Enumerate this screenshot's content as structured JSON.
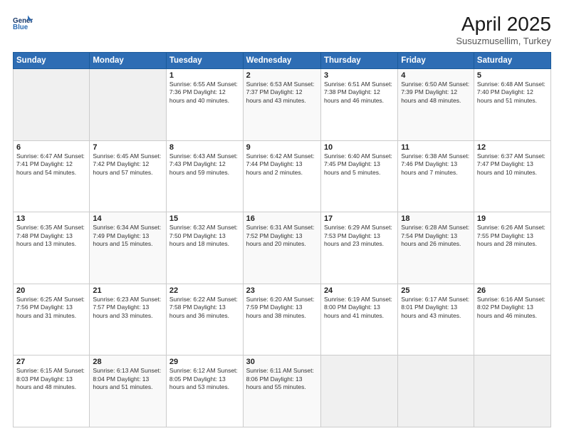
{
  "header": {
    "title": "April 2025",
    "subtitle": "Susuzmusellim, Turkey",
    "logo_line1": "General",
    "logo_line2": "Blue"
  },
  "days": [
    "Sunday",
    "Monday",
    "Tuesday",
    "Wednesday",
    "Thursday",
    "Friday",
    "Saturday"
  ],
  "weeks": [
    [
      {
        "day": "",
        "info": ""
      },
      {
        "day": "",
        "info": ""
      },
      {
        "day": "1",
        "info": "Sunrise: 6:55 AM\nSunset: 7:36 PM\nDaylight: 12 hours and 40 minutes."
      },
      {
        "day": "2",
        "info": "Sunrise: 6:53 AM\nSunset: 7:37 PM\nDaylight: 12 hours and 43 minutes."
      },
      {
        "day": "3",
        "info": "Sunrise: 6:51 AM\nSunset: 7:38 PM\nDaylight: 12 hours and 46 minutes."
      },
      {
        "day": "4",
        "info": "Sunrise: 6:50 AM\nSunset: 7:39 PM\nDaylight: 12 hours and 48 minutes."
      },
      {
        "day": "5",
        "info": "Sunrise: 6:48 AM\nSunset: 7:40 PM\nDaylight: 12 hours and 51 minutes."
      }
    ],
    [
      {
        "day": "6",
        "info": "Sunrise: 6:47 AM\nSunset: 7:41 PM\nDaylight: 12 hours and 54 minutes."
      },
      {
        "day": "7",
        "info": "Sunrise: 6:45 AM\nSunset: 7:42 PM\nDaylight: 12 hours and 57 minutes."
      },
      {
        "day": "8",
        "info": "Sunrise: 6:43 AM\nSunset: 7:43 PM\nDaylight: 12 hours and 59 minutes."
      },
      {
        "day": "9",
        "info": "Sunrise: 6:42 AM\nSunset: 7:44 PM\nDaylight: 13 hours and 2 minutes."
      },
      {
        "day": "10",
        "info": "Sunrise: 6:40 AM\nSunset: 7:45 PM\nDaylight: 13 hours and 5 minutes."
      },
      {
        "day": "11",
        "info": "Sunrise: 6:38 AM\nSunset: 7:46 PM\nDaylight: 13 hours and 7 minutes."
      },
      {
        "day": "12",
        "info": "Sunrise: 6:37 AM\nSunset: 7:47 PM\nDaylight: 13 hours and 10 minutes."
      }
    ],
    [
      {
        "day": "13",
        "info": "Sunrise: 6:35 AM\nSunset: 7:48 PM\nDaylight: 13 hours and 13 minutes."
      },
      {
        "day": "14",
        "info": "Sunrise: 6:34 AM\nSunset: 7:49 PM\nDaylight: 13 hours and 15 minutes."
      },
      {
        "day": "15",
        "info": "Sunrise: 6:32 AM\nSunset: 7:50 PM\nDaylight: 13 hours and 18 minutes."
      },
      {
        "day": "16",
        "info": "Sunrise: 6:31 AM\nSunset: 7:52 PM\nDaylight: 13 hours and 20 minutes."
      },
      {
        "day": "17",
        "info": "Sunrise: 6:29 AM\nSunset: 7:53 PM\nDaylight: 13 hours and 23 minutes."
      },
      {
        "day": "18",
        "info": "Sunrise: 6:28 AM\nSunset: 7:54 PM\nDaylight: 13 hours and 26 minutes."
      },
      {
        "day": "19",
        "info": "Sunrise: 6:26 AM\nSunset: 7:55 PM\nDaylight: 13 hours and 28 minutes."
      }
    ],
    [
      {
        "day": "20",
        "info": "Sunrise: 6:25 AM\nSunset: 7:56 PM\nDaylight: 13 hours and 31 minutes."
      },
      {
        "day": "21",
        "info": "Sunrise: 6:23 AM\nSunset: 7:57 PM\nDaylight: 13 hours and 33 minutes."
      },
      {
        "day": "22",
        "info": "Sunrise: 6:22 AM\nSunset: 7:58 PM\nDaylight: 13 hours and 36 minutes."
      },
      {
        "day": "23",
        "info": "Sunrise: 6:20 AM\nSunset: 7:59 PM\nDaylight: 13 hours and 38 minutes."
      },
      {
        "day": "24",
        "info": "Sunrise: 6:19 AM\nSunset: 8:00 PM\nDaylight: 13 hours and 41 minutes."
      },
      {
        "day": "25",
        "info": "Sunrise: 6:17 AM\nSunset: 8:01 PM\nDaylight: 13 hours and 43 minutes."
      },
      {
        "day": "26",
        "info": "Sunrise: 6:16 AM\nSunset: 8:02 PM\nDaylight: 13 hours and 46 minutes."
      }
    ],
    [
      {
        "day": "27",
        "info": "Sunrise: 6:15 AM\nSunset: 8:03 PM\nDaylight: 13 hours and 48 minutes."
      },
      {
        "day": "28",
        "info": "Sunrise: 6:13 AM\nSunset: 8:04 PM\nDaylight: 13 hours and 51 minutes."
      },
      {
        "day": "29",
        "info": "Sunrise: 6:12 AM\nSunset: 8:05 PM\nDaylight: 13 hours and 53 minutes."
      },
      {
        "day": "30",
        "info": "Sunrise: 6:11 AM\nSunset: 8:06 PM\nDaylight: 13 hours and 55 minutes."
      },
      {
        "day": "",
        "info": ""
      },
      {
        "day": "",
        "info": ""
      },
      {
        "day": "",
        "info": ""
      }
    ]
  ]
}
